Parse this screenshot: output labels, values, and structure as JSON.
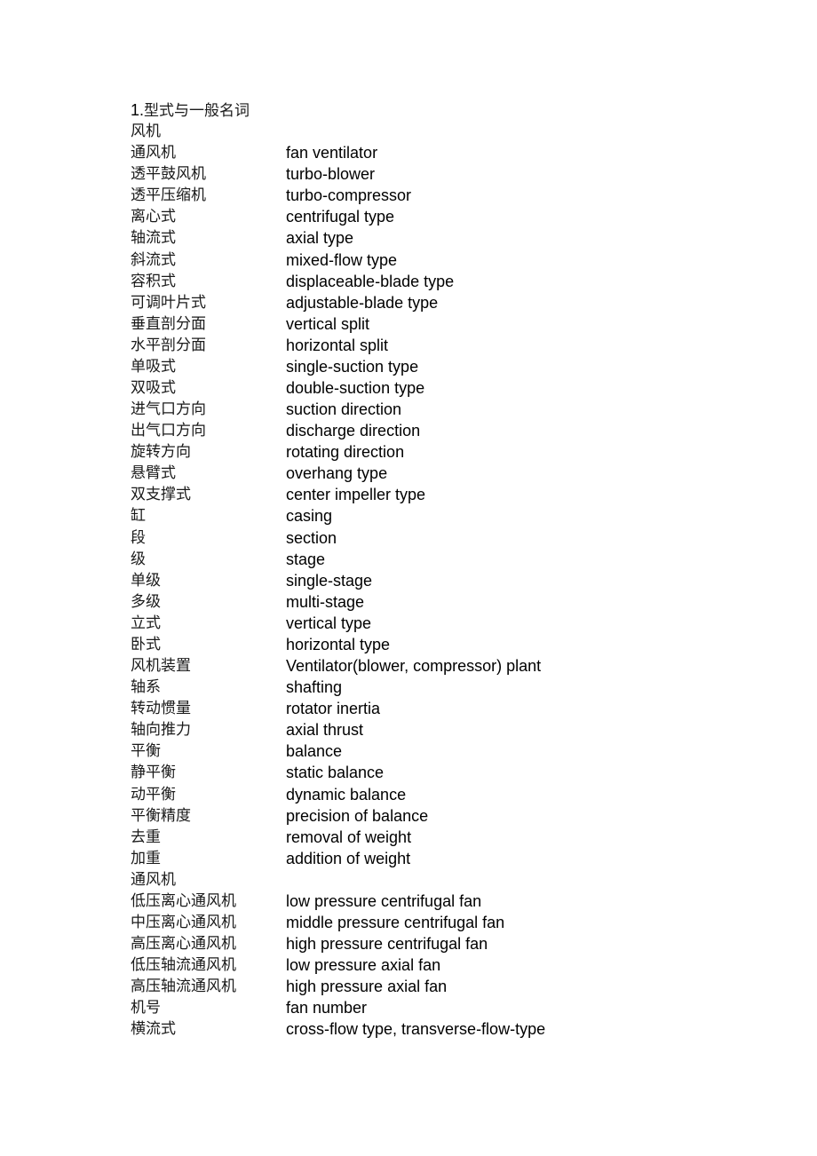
{
  "document": {
    "heading_number": "1.",
    "heading_text": "型式与一般名词",
    "entries": [
      {
        "zh": "风机",
        "en": ""
      },
      {
        "zh": "通风机",
        "en": "fan ventilator"
      },
      {
        "zh": "透平鼓风机",
        "en": "turbo-blower"
      },
      {
        "zh": "透平压缩机",
        "en": "turbo-compressor"
      },
      {
        "zh": "离心式",
        "en": "centrifugal type"
      },
      {
        "zh": "轴流式",
        "en": "axial type"
      },
      {
        "zh": "斜流式",
        "en": "mixed-flow type"
      },
      {
        "zh": "容积式",
        "en": "displaceable-blade type"
      },
      {
        "zh": "可调叶片式",
        "en": "adjustable-blade type"
      },
      {
        "zh": "垂直剖分面",
        "en": "vertical split"
      },
      {
        "zh": "水平剖分面",
        "en": "horizontal split"
      },
      {
        "zh": "单吸式",
        "en": "single-suction type"
      },
      {
        "zh": "双吸式",
        "en": "double-suction type"
      },
      {
        "zh": "进气口方向",
        "en": "suction direction"
      },
      {
        "zh": "出气口方向",
        "en": "discharge direction"
      },
      {
        "zh": "旋转方向",
        "en": "rotating direction"
      },
      {
        "zh": "悬臂式",
        "en": "overhang type"
      },
      {
        "zh": "双支撑式",
        "en": "center impeller type"
      },
      {
        "zh": "缸",
        "en": "casing"
      },
      {
        "zh": "段",
        "en": "section"
      },
      {
        "zh": "级",
        "en": "stage"
      },
      {
        "zh": "单级",
        "en": "single-stage"
      },
      {
        "zh": "多级",
        "en": "multi-stage"
      },
      {
        "zh": "立式",
        "en": "vertical type"
      },
      {
        "zh": "卧式",
        "en": "horizontal type"
      },
      {
        "zh": "风机装置",
        "en": "Ventilator(blower, compressor) plant"
      },
      {
        "zh": "轴系",
        "en": "shafting"
      },
      {
        "zh": "转动惯量",
        "en": "rotator inertia"
      },
      {
        "zh": "轴向推力",
        "en": "axial thrust"
      },
      {
        "zh": "平衡",
        "en": "balance"
      },
      {
        "zh": "静平衡",
        "en": "static balance"
      },
      {
        "zh": "动平衡",
        "en": "dynamic balance"
      },
      {
        "zh": "平衡精度",
        "en": "precision of balance"
      },
      {
        "zh": "去重",
        "en": "removal of weight"
      },
      {
        "zh": "加重",
        "en": "addition of weight"
      },
      {
        "zh": "通风机",
        "en": ""
      },
      {
        "zh": "低压离心通风机",
        "en": "low pressure centrifugal fan"
      },
      {
        "zh": "中压离心通风机",
        "en": "middle pressure centrifugal fan"
      },
      {
        "zh": "高压离心通风机",
        "en": "high pressure centrifugal fan"
      },
      {
        "zh": "低压轴流通风机",
        "en": "low pressure axial fan"
      },
      {
        "zh": "高压轴流通风机",
        "en": "high pressure axial fan"
      },
      {
        "zh": "机号",
        "en": "fan number"
      },
      {
        "zh": "横流式",
        "en": "cross-flow type, transverse-flow-type"
      }
    ]
  }
}
